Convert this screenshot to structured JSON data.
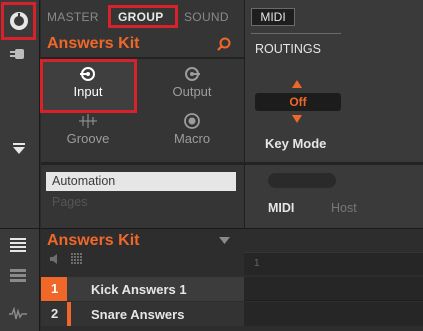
{
  "tabs": {
    "master": "MASTER",
    "group": "GROUP",
    "sound": "SOUND"
  },
  "kit_panel": {
    "title": "Answers Kit"
  },
  "page_grid": {
    "input": "Input",
    "output": "Output",
    "groove": "Groove",
    "macro": "Macro"
  },
  "automation": {
    "label": "Automation",
    "pages_label": "Pages"
  },
  "midi_panel": {
    "tab": "MIDI",
    "routings_label": "ROUTINGS",
    "key_mode_value": "Off",
    "key_mode_label": "Key Mode",
    "midi_label": "MIDI",
    "host_label": "Host"
  },
  "group_list": {
    "title": "Answers Kit",
    "ruler_number": "1",
    "tracks": [
      {
        "number": "1",
        "name": "Kick Answers 1"
      },
      {
        "number": "2",
        "name": "Snare Answers"
      }
    ]
  },
  "colors": {
    "accent_orange": "#f0672a",
    "highlight_red": "#d6222a"
  }
}
